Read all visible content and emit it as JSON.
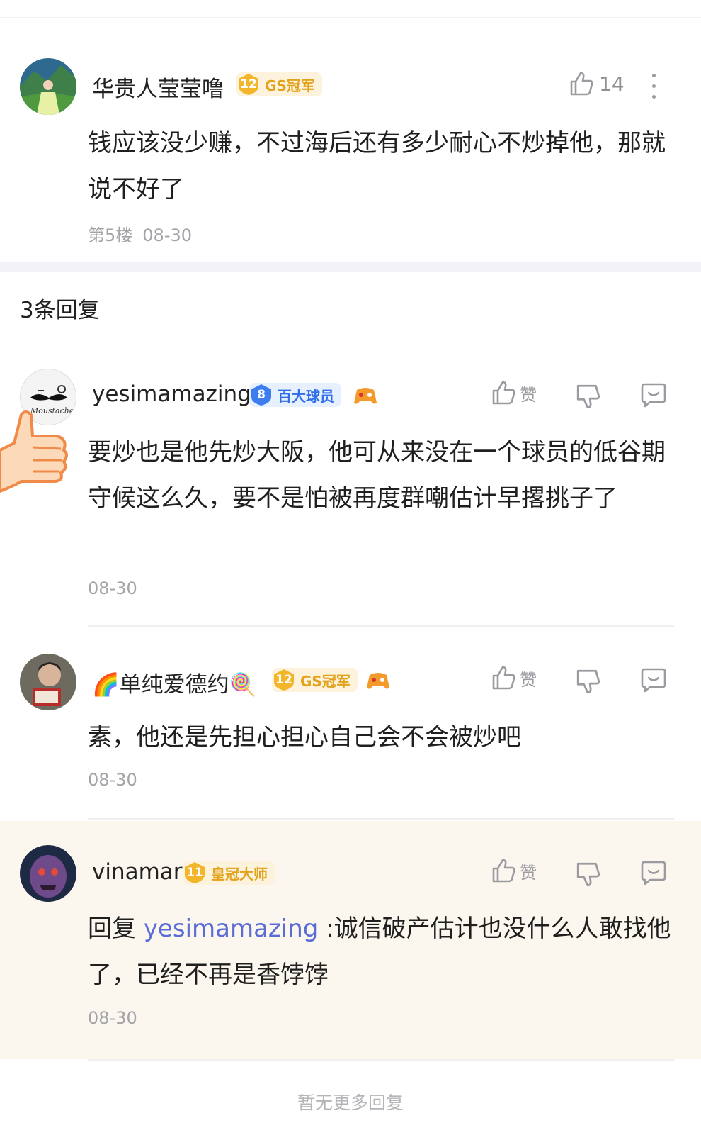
{
  "main_comment": {
    "username": "华贵人莹莹噜",
    "badge_level": "12",
    "badge_text": "GS冠军",
    "like_count": "14",
    "text": "钱应该没少赚，不过海后还有多少耐心不炒掉他，那就说不好了",
    "floor": "第5楼",
    "date": "08-30"
  },
  "replies_title": "3条回复",
  "replies": [
    {
      "username": "yesimamazing",
      "badge_level": "8",
      "badge_text": "百大球员",
      "like_label": "赞",
      "text": "要炒也是他先炒大阪，他可从来没在一个球员的低谷期守候这么久，要不是怕被再度群嘲估计早撂挑子了",
      "date": "08-30"
    },
    {
      "username": "🌈单纯爱德约🍭",
      "badge_level": "12",
      "badge_text": "GS冠军",
      "like_label": "赞",
      "text": "素，他还是先担心担心自己会不会被炒吧",
      "date": "08-30"
    },
    {
      "username": "vinamar",
      "badge_level": "11",
      "badge_text": "皇冠大师",
      "like_label": "赞",
      "reply_prefix": "回复 ",
      "mention": "yesimamazing",
      "text": " :诚信破产估计也没什么人敢找他了，已经不再是香饽饽",
      "date": "08-30"
    }
  ],
  "footer": "暂无更多回复",
  "colors": {
    "gold_badge": "#e2a21b",
    "blue_badge": "#2f6ee8",
    "mention": "#5b6cd6",
    "highlight_bg": "#fbf7ee"
  },
  "icons": [
    "thumbs-up-icon",
    "thumbs-down-icon",
    "comment-icon",
    "more-vertical-icon",
    "shield-level-icon",
    "game-controller-icon",
    "thumbs-up-sticker"
  ]
}
